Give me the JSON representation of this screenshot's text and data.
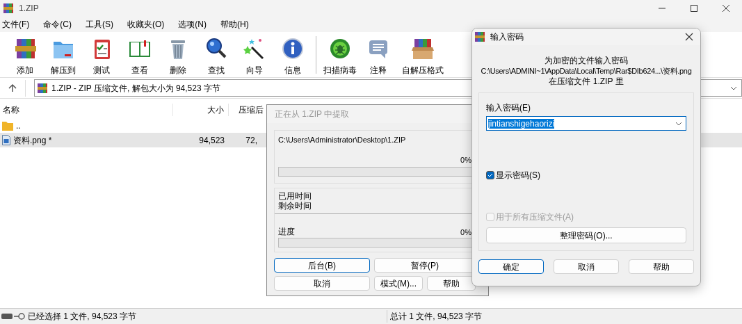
{
  "window": {
    "title": "1.ZIP"
  },
  "menu": [
    {
      "label": "文件(F)"
    },
    {
      "label": "命令(C)"
    },
    {
      "label": "工具(S)"
    },
    {
      "label": "收藏夹(O)"
    },
    {
      "label": "选项(N)"
    },
    {
      "label": "帮助(H)"
    }
  ],
  "toolbar": {
    "groups": [
      [
        {
          "label": "添加"
        },
        {
          "label": "解压到"
        },
        {
          "label": "测试"
        },
        {
          "label": "查看"
        },
        {
          "label": "删除"
        },
        {
          "label": "查找"
        },
        {
          "label": "向导"
        },
        {
          "label": "信息"
        }
      ],
      [
        {
          "label": "扫描病毒"
        },
        {
          "label": "注释"
        },
        {
          "label": "自解压格式"
        }
      ]
    ]
  },
  "address": {
    "text": "1.ZIP - ZIP 压缩文件, 解包大小为 94,523 字节"
  },
  "file_list": {
    "columns": [
      "名称",
      "大小",
      "压缩后"
    ],
    "rows": [
      {
        "kind": "folder",
        "name": "..",
        "size": "",
        "packed": "",
        "selected": false
      },
      {
        "kind": "file",
        "name": "资料.png *",
        "size": "94,523",
        "packed": "72,",
        "selected": true
      }
    ]
  },
  "status_bar": {
    "left": "已经选择 1 文件, 94,523 字节",
    "right": "总计 1 文件, 94,523 字节"
  },
  "extract_dialog": {
    "title": "正在从 1.ZIP 中提取",
    "path": "C:\\Users\\Administrator\\Desktop\\1.ZIP",
    "file_progress": {
      "percent": "0%",
      "level": 0
    },
    "elapsed_label": "已用时间",
    "remaining_label": "剩余时间",
    "progress_label": "进度",
    "total_progress": {
      "percent": "0%",
      "level": 0
    },
    "buttons": [
      {
        "label": "后台(B)",
        "focused": true
      },
      {
        "label": "暂停(P)",
        "focused": false
      },
      {
        "label": "取消",
        "focused": false
      },
      {
        "label": "模式(M)...",
        "focused": false
      },
      {
        "label": "帮助",
        "focused": false
      }
    ]
  },
  "password_dialog": {
    "title": "输入密码",
    "prompt": "为加密的文件输入密码",
    "path": "C:\\Users\\ADMINI~1\\AppData\\Local\\Temp\\Rar$DIb624...\\资料.png",
    "archive_line": "在压缩文件 1.ZIP 里",
    "field_label": "输入密码(E)",
    "value": "jintianshigehaorizi",
    "show_password": {
      "label": "显示密码(S)",
      "checked": true,
      "disabled": false
    },
    "use_for_all": {
      "label": "用于所有压缩文件(A)",
      "checked": false,
      "disabled": true
    },
    "organize_button": "整理密码(O)...",
    "buttons": [
      {
        "label": "确定",
        "focused": true
      },
      {
        "label": "取消",
        "focused": false
      },
      {
        "label": "帮助",
        "focused": false
      }
    ]
  }
}
